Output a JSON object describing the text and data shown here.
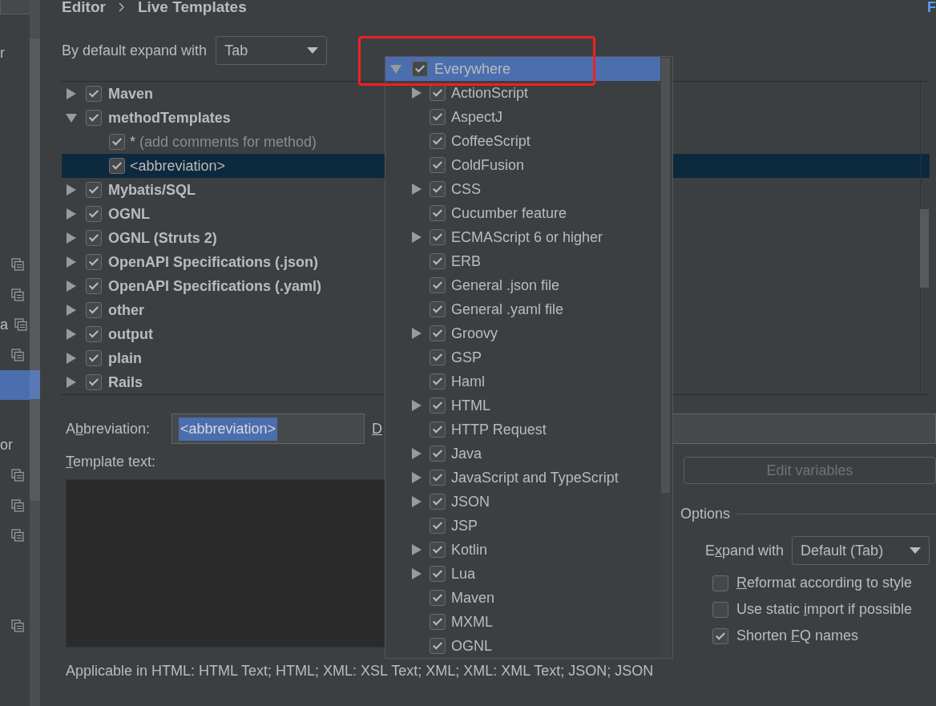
{
  "sidebar": {
    "items": [
      {
        "kind": "text",
        "text": "r",
        "selected": false
      },
      {
        "kind": "icon",
        "selected": false
      },
      {
        "kind": "icon",
        "selected": false
      },
      {
        "kind": "text_icon",
        "text": "a",
        "selected": false
      },
      {
        "kind": "icon",
        "selected": false
      },
      {
        "kind": "blank",
        "selected": true
      },
      {
        "kind": "text",
        "text": "or",
        "selected": false
      },
      {
        "kind": "icon",
        "selected": false
      },
      {
        "kind": "icon",
        "selected": false
      },
      {
        "kind": "icon",
        "selected": false
      },
      {
        "kind": "icon",
        "selected": false
      }
    ]
  },
  "breadcrumb": [
    "Editor",
    "Live Templates"
  ],
  "top_right_link": "F",
  "expand_default": {
    "label": "By default expand with",
    "value": "Tab"
  },
  "templates": [
    {
      "label": "Maven",
      "checked": true,
      "expanded": false,
      "selected": false
    },
    {
      "label": "methodTemplates",
      "checked": true,
      "expanded": true,
      "selected": false,
      "children": [
        {
          "abbreviation": "*",
          "description": "(add comments for method)",
          "checked": true,
          "selected": false
        },
        {
          "abbreviation": "<abbreviation>",
          "checked": true,
          "selected": true
        }
      ]
    },
    {
      "label": "Mybatis/SQL",
      "checked": true,
      "expanded": false,
      "selected": false
    },
    {
      "label": "OGNL",
      "checked": true,
      "expanded": false,
      "selected": false
    },
    {
      "label": "OGNL (Struts 2)",
      "checked": true,
      "expanded": false,
      "selected": false
    },
    {
      "label": "OpenAPI Specifications (.json)",
      "checked": true,
      "expanded": false,
      "selected": false
    },
    {
      "label": "OpenAPI Specifications (.yaml)",
      "checked": true,
      "expanded": false,
      "selected": false
    },
    {
      "label": "other",
      "checked": true,
      "expanded": false,
      "selected": false
    },
    {
      "label": "output",
      "checked": true,
      "expanded": false,
      "selected": false
    },
    {
      "label": "plain",
      "checked": true,
      "expanded": false,
      "selected": false
    },
    {
      "label": "Rails",
      "checked": true,
      "expanded": false,
      "selected": false
    }
  ],
  "abbreviation": {
    "label": {
      "before": "A",
      "mnemonic": "b",
      "after": "breviation:"
    },
    "value": "<abbreviation>",
    "text_selected": true
  },
  "description": {
    "label": {
      "mnemonic": "D"
    }
  },
  "template_text": {
    "label": {
      "mnemonic": "T",
      "after": "emplate text:"
    }
  },
  "edit_variables": {
    "label": "Edit variables",
    "disabled": true
  },
  "options": {
    "title": "Options",
    "expand_with": {
      "label": {
        "before": "E",
        "mnemonic": "x",
        "after": "pand with"
      },
      "value": "Default (Tab)"
    },
    "checkboxes": [
      {
        "label": {
          "mnemonic": "R",
          "after": "eformat according to style"
        },
        "checked": false
      },
      {
        "label": {
          "before": "Use static ",
          "mnemonic": "i",
          "after": "mport if possible"
        },
        "checked": false
      },
      {
        "label": {
          "before": "Shorten ",
          "mnemonic": "F",
          "after": "Q names"
        },
        "checked": true
      }
    ]
  },
  "applicable": "Applicable in HTML: HTML Text; HTML; XML: XSL Text; XML; XML: XML Text; JSON; JSON",
  "context_popup": {
    "label": "Everywhere",
    "checked": true,
    "expanded": true,
    "selected": true,
    "children": [
      {
        "label": "ActionScript",
        "checked": true,
        "expandable": true
      },
      {
        "label": "AspectJ",
        "checked": true,
        "expandable": false
      },
      {
        "label": "CoffeeScript",
        "checked": true,
        "expandable": false
      },
      {
        "label": "ColdFusion",
        "checked": true,
        "expandable": false
      },
      {
        "label": "CSS",
        "checked": true,
        "expandable": true
      },
      {
        "label": "Cucumber feature",
        "checked": true,
        "expandable": false
      },
      {
        "label": "ECMAScript 6 or higher",
        "checked": true,
        "expandable": true
      },
      {
        "label": "ERB",
        "checked": true,
        "expandable": false
      },
      {
        "label": "General .json file",
        "checked": true,
        "expandable": false
      },
      {
        "label": "General .yaml file",
        "checked": true,
        "expandable": false
      },
      {
        "label": "Groovy",
        "checked": true,
        "expandable": true
      },
      {
        "label": "GSP",
        "checked": true,
        "expandable": false
      },
      {
        "label": "Haml",
        "checked": true,
        "expandable": false
      },
      {
        "label": "HTML",
        "checked": true,
        "expandable": true
      },
      {
        "label": "HTTP Request",
        "checked": true,
        "expandable": false
      },
      {
        "label": "Java",
        "checked": true,
        "expandable": true
      },
      {
        "label": "JavaScript and TypeScript",
        "checked": true,
        "expandable": true
      },
      {
        "label": "JSON",
        "checked": true,
        "expandable": true
      },
      {
        "label": "JSP",
        "checked": true,
        "expandable": false
      },
      {
        "label": "Kotlin",
        "checked": true,
        "expandable": true
      },
      {
        "label": "Lua",
        "checked": true,
        "expandable": true
      },
      {
        "label": "Maven",
        "checked": true,
        "expandable": false
      },
      {
        "label": "MXML",
        "checked": true,
        "expandable": false
      },
      {
        "label": "OGNL",
        "checked": true,
        "expandable": false
      }
    ]
  }
}
